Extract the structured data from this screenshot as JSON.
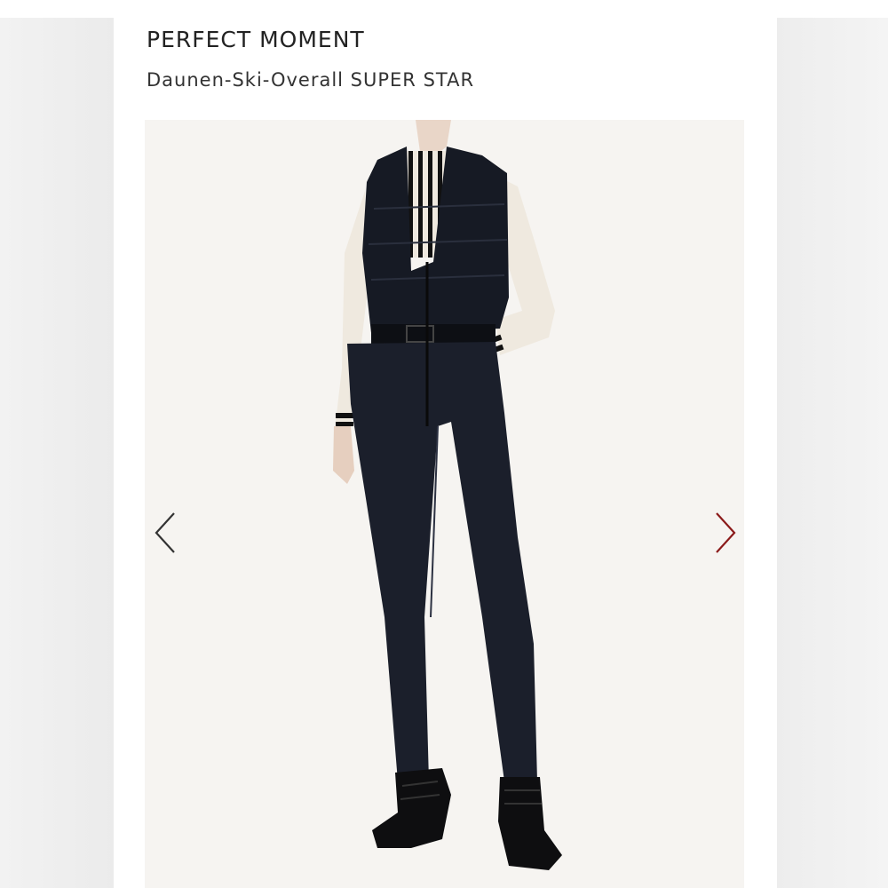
{
  "product": {
    "brand": "PERFECT MOMENT",
    "name": "Daunen-Ski-Overall SUPER STAR"
  },
  "gallery": {
    "image_alt": "Model wearing black down ski overall with cream turtleneck and black snow boots",
    "prev_arrow_color": "#333333",
    "next_arrow_color": "#8b1a1a"
  }
}
